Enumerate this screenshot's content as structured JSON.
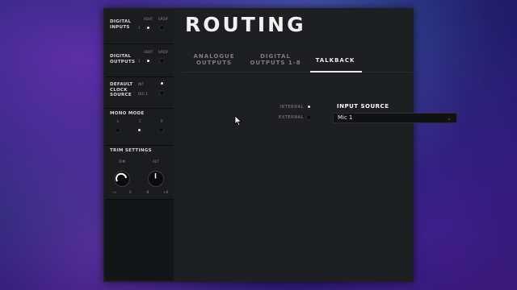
{
  "sidebar": {
    "digital_inputs": {
      "label": "DIGITAL\nINPUTS",
      "opt_a": "ADAT",
      "opt_b": "SPDIF",
      "row_num": "1"
    },
    "digital_outputs": {
      "label": "DIGITAL\nOUTPUTS",
      "opt_a": "ADAT",
      "opt_b": "SPDIF",
      "row_num": "1"
    },
    "clock": {
      "label": "DEFAULT\nCLOCK\nSOURCE",
      "opt_int": "INT",
      "opt_dig": "DIG 1"
    },
    "mono_mode": {
      "label": "MONO MODE",
      "l": "L",
      "c": "C",
      "r": "R"
    },
    "trim": {
      "label": "TRIM SETTINGS",
      "dim": "DIM",
      "alt": "ALT",
      "dim_min": "-∞",
      "dim_max": "0",
      "alt_min": "-8",
      "alt_max": "+8"
    }
  },
  "main": {
    "title": "ROUTING",
    "tabs": [
      {
        "label": "ANALOGUE\nOUTPUTS",
        "active": false
      },
      {
        "label": "DIGITAL\nOUTPUTS 1-8",
        "active": false
      },
      {
        "label": "TALKBACK",
        "active": true
      }
    ],
    "talkback": {
      "internal_label": "INTERNAL",
      "external_label": "EXTERNAL",
      "input_source_label": "INPUT SOURCE",
      "input_source_value": "Mic 1"
    }
  }
}
